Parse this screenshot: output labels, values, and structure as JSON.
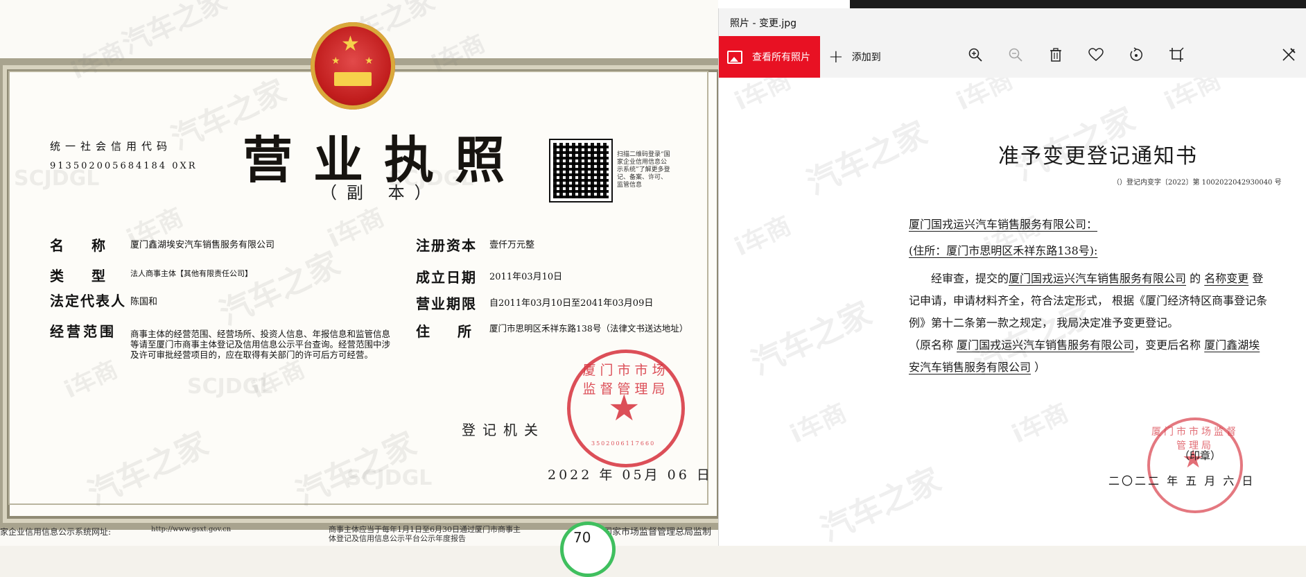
{
  "watermark": {
    "brand_a": "汽车之家",
    "brand_b": "i车商",
    "code": "SCJDGL"
  },
  "license": {
    "usc_label": "统一社会信用代码",
    "usc_code": "913502005684184 0XR",
    "title": "营业执照",
    "subtitle": "（副 本）",
    "qr_note": "扫描二维码登录“国家企业信用信息公示系统”了解更多登记、备案、许可、监管信息",
    "fields": {
      "name_label": "名称",
      "name_value": "厦门鑫湖埃安汽车销售服务有限公司",
      "type_label": "类型",
      "type_value": "法人商事主体【其他有限责任公司】",
      "rep_label": "法定代表人",
      "rep_value": "陈国和",
      "scope_label": "经营范围",
      "scope_value": "商事主体的经营范围、经营场所、投资人信息、年报信息和监管信息等请至厦门市商事主体登记及信用信息公示平台查询。经营范围中涉及许可审批经营项目的，应在取得有关部门的许可后方可经营。",
      "capital_label": "注册资本",
      "capital_value": "壹仟万元整",
      "date_label": "成立日期",
      "date_value": "2011年03月10日",
      "term_label": "营业期限",
      "term_value": "自2011年03月10日至2041年03月09日",
      "address_label": "住所",
      "address_value": "厦门市思明区禾祥东路138号（法律文书送达地址）"
    },
    "seal": {
      "ring_text": "厦门市市场监督管理局",
      "number": "3502006117660"
    },
    "authority_label": "登记机关",
    "issue_date": "2022 年 05月 06 日",
    "footer": {
      "gsxt_label": "家企业信用信息公示系统网址:",
      "gsxt_url": "http://www.gsxt.gov.cn",
      "report_note": "商事主体应当于每年1月1日至6月30日通过厦门市商事主体登记及信用信息公示平台公示年度报告",
      "issuer": "国家市场监督管理总局监制"
    }
  },
  "photos": {
    "window_title": "照片 - 变更.jpg",
    "toolbar": {
      "view_all_label": "查看所有照片",
      "add_to_label": "添加到"
    },
    "document": {
      "title": "准予变更登记通知书",
      "ref": "（）登记内变字〔2022〕第 1002022042930040 号",
      "addressee": "厦门国戎运兴汽车销售服务有限公司：",
      "address": "(住所：厦门市思明区禾祥东路138号):",
      "body_intro": "经审查，提交的",
      "body_company": "厦门国戎运兴汽车销售服务有限公司",
      "body_de": "的",
      "body_item": "名称变更",
      "body_rest": "登记申请，申请材料齐全，符合法定形式， 根据《厦门经济特区商事登记条例》第十二条第一款之规定， 我局决定准予变更登记。",
      "old_name_label": "（原名称",
      "old_name": "厦门国戎运兴汽车销售服务有限公司",
      "new_name_label": "，变更后名称",
      "new_name": "厦门鑫湖埃安汽车销售服务有限公司",
      "close_paren": "）",
      "seal_ring": "厦门市市场监督管理局",
      "stamp_label": "（印章）",
      "date": "二〇二二 年 五 月 六 日"
    },
    "zoom_badge": "70"
  }
}
